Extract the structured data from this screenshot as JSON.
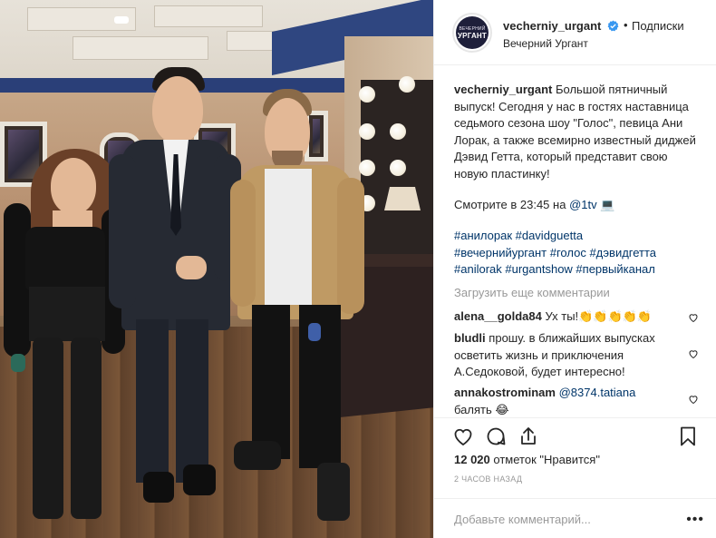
{
  "header": {
    "username": "vecherniy_urgant",
    "separator": "•",
    "follow_label": "Подписки",
    "subtitle": "Вечерний Ургант",
    "avatar_line1": "ВЕЧЕРНИЙ",
    "avatar_line2": "УРГАНТ"
  },
  "caption": {
    "username": "vecherniy_urgant",
    "text": "Большой пятничный выпуск! Сегодня у нас в гостях наставница седьмого сезона шоу \"Голос\", певица Ани Лорак, а также всемирно известный диджей Дэвид Гетта, который представит свою новую пластинку!",
    "watch_prefix": "Смотрите в 23:45 на ",
    "watch_link": "@1tv",
    "watch_emoji": "💻",
    "tags_line1": "#анилорак #davidguetta",
    "tags_line2": "#вечернийургант #голос #дэвидгетта",
    "tags_line3": "#anilorak #urgantshow #первыйканал"
  },
  "load_more": "Загрузить еще комментарии",
  "comments": [
    {
      "username": "alena__golda84",
      "text": "Ух ты!👏👏👏👏👏"
    },
    {
      "username": "bludli",
      "text": "прошу. в ближайших выпусках осветить жизнь и приключения А.Седоковой, будет интересно!"
    },
    {
      "username": "annakostrominam",
      "mention": "@8374.tatiana",
      "text": "балять 😂"
    }
  ],
  "likes": {
    "count": "12 020",
    "suffix": "отметок \"Нравится\""
  },
  "timestamp": "2 ЧАСОВ НАЗАД",
  "add_comment_placeholder": "Добавьте комментарий...",
  "more_label": "•••",
  "icons": [
    "heart-icon",
    "comment-icon",
    "share-icon",
    "bookmark-icon",
    "verified-icon"
  ],
  "colors": {
    "link": "#003569",
    "muted": "#999999",
    "text": "#262626",
    "verified": "#3897f0"
  }
}
